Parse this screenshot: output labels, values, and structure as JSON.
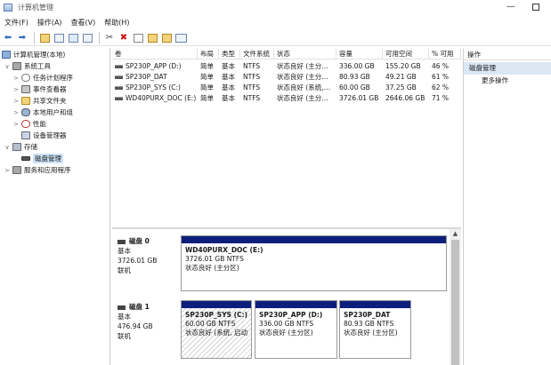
{
  "window": {
    "title": "计算机管理"
  },
  "menu": [
    {
      "id": "file",
      "label": "文件(F)"
    },
    {
      "id": "action",
      "label": "操作(A)"
    },
    {
      "id": "view",
      "label": "查看(V)"
    },
    {
      "id": "help",
      "label": "帮助(H)"
    }
  ],
  "toolbar": [
    "back-icon",
    "forward-icon",
    "up-folder-icon",
    "show-tree-icon",
    "help-icon",
    "console-icon",
    "connect-icon",
    "delete-icon",
    "properties-icon",
    "open-icon",
    "search-icon",
    "more-icon"
  ],
  "tree": {
    "root": "计算机管理(本地)",
    "system_tools": "系统工具",
    "task_scheduler": "任务计划程序",
    "event_viewer": "事件查看器",
    "shared_folders": "共享文件夹",
    "local_users": "本地用户和组",
    "performance": "性能",
    "device_manager": "设备管理器",
    "storage": "存储",
    "disk_management": "磁盘管理",
    "services_apps": "服务和应用程序"
  },
  "volume_table": {
    "headers": [
      "卷",
      "布局",
      "类型",
      "文件系统",
      "状态",
      "容量",
      "可用空间",
      "% 可用"
    ],
    "rows": [
      [
        "SP230P_APP (D:)",
        "简单",
        "基本",
        "NTFS",
        "状态良好 (主分…",
        "336.00 GB",
        "155.20 GB",
        "46 %"
      ],
      [
        "SP230P_DAT",
        "简单",
        "基本",
        "NTFS",
        "状态良好 (主分…",
        "80.93 GB",
        "49.21 GB",
        "61 %"
      ],
      [
        "SP230P_SYS (C:)",
        "简单",
        "基本",
        "NTFS",
        "状态良好 (系统,…",
        "60.00 GB",
        "37.25 GB",
        "62 %"
      ],
      [
        "WD40PURX_DOC (E:)",
        "简单",
        "基本",
        "NTFS",
        "状态良好 (主分…",
        "3726.01 GB",
        "2646.06 GB",
        "71 %"
      ]
    ]
  },
  "actions": {
    "header": "操作",
    "section": "磁盘管理",
    "more": "更多操作"
  },
  "disks": {
    "disk0": {
      "name": "磁盘 0",
      "type": "基本",
      "size": "3726.01 GB",
      "status": "联机",
      "partition": {
        "name": "WD40PURX_DOC  (E:)",
        "size": "3726.01 GB NTFS",
        "status": "状态良好 (主分区)"
      }
    },
    "disk1": {
      "name": "磁盘 1",
      "type": "基本",
      "size": "476.94 GB",
      "status": "联机",
      "partitions": [
        {
          "name": "SP230P_SYS  (C:)",
          "size": "60.00 GB NTFS",
          "status": "状态良好 (系统, 启动"
        },
        {
          "name": "SP230P_APP  (D:)",
          "size": "336.00 GB NTFS",
          "status": "状态良好 (主分区)"
        },
        {
          "name": "SP230P_DAT",
          "size": "80.93 GB NTFS",
          "status": "状态良好 (主分区)"
        }
      ]
    }
  },
  "colors": {
    "partition_bar": "#0c1f7a",
    "selection": "#cde3f7",
    "actions_section": "#dbe6f3"
  }
}
